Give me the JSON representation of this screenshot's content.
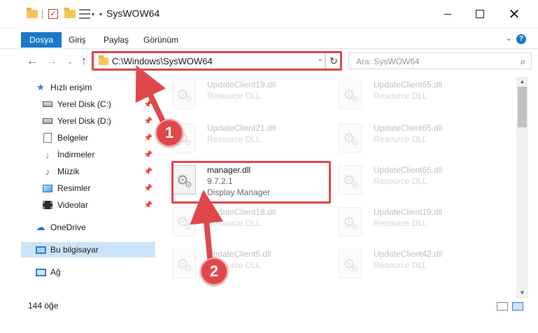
{
  "window": {
    "title": "SysWOW64",
    "quick_access": [
      "folder-icon",
      "checkbox-icon",
      "folder-icon",
      "properties-icon"
    ]
  },
  "ribbon": {
    "tabs": [
      {
        "label": "Dosya",
        "active": true
      },
      {
        "label": "Giriş",
        "active": false
      },
      {
        "label": "Paylaş",
        "active": false
      },
      {
        "label": "Görünüm",
        "active": false
      }
    ]
  },
  "address": {
    "path": "C:\\Windows\\SysWOW64"
  },
  "search": {
    "placeholder": "Ara: SysWOW64"
  },
  "sidebar": {
    "items": [
      {
        "label": "Hızlı erişim",
        "icon": "star-icon"
      },
      {
        "label": "Yerel Disk (C:)",
        "icon": "drive-icon",
        "pinned": true
      },
      {
        "label": "Yerel Disk (D:)",
        "icon": "drive-icon",
        "pinned": true
      },
      {
        "label": "Belgeler",
        "icon": "documents-icon",
        "pinned": true
      },
      {
        "label": "İndirmeler",
        "icon": "downloads-icon",
        "pinned": true
      },
      {
        "label": "Müzik",
        "icon": "music-icon",
        "pinned": true
      },
      {
        "label": "Resimler",
        "icon": "pictures-icon",
        "pinned": true
      },
      {
        "label": "Videolar",
        "icon": "videos-icon",
        "pinned": true
      },
      {
        "label": "OneDrive",
        "icon": "cloud-icon"
      },
      {
        "label": "Bu bilgisayar",
        "icon": "computer-icon",
        "selected": true
      },
      {
        "label": "Ağ",
        "icon": "network-icon"
      }
    ]
  },
  "files": {
    "left": [
      {
        "name": "UpdateClient19.dll",
        "sub1": "Resource DLL"
      },
      {
        "name": "UpdateClient21.dll",
        "sub1": "Resource DLL"
      },
      {
        "name": "manager.dll",
        "sub1": "9.7.2.1",
        "sub2": "Display Manager",
        "highlighted": true
      },
      {
        "name": "UpdateClient18.dll",
        "sub1": "Resource DLL"
      },
      {
        "name": "UpdateClient5.dll",
        "sub1": "Resource DLL"
      }
    ],
    "right": [
      {
        "name": "UpdateClient65.dll",
        "sub1": "Resource DLL"
      },
      {
        "name": "UpdateClient65.dll",
        "sub1": "Resource DLL"
      },
      {
        "name": "UpdateClient65.dll",
        "sub1": "Resource DLL"
      },
      {
        "name": "UpdateClient19.dll",
        "sub1": "Resource DLL"
      },
      {
        "name": "UpdateClient42.dll",
        "sub1": "Resource DLL"
      }
    ]
  },
  "status": {
    "count": "144 öğe"
  },
  "annotations": {
    "step1": "1",
    "step2": "2",
    "color": "#e0474c"
  },
  "colors": {
    "accent": "#1979ca",
    "selection": "#cce4f7"
  }
}
